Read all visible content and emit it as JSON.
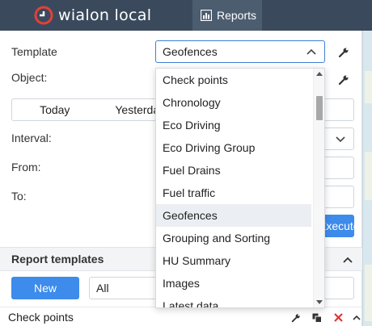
{
  "topbar": {
    "logo_text": "wialon local",
    "reports_tab_label": "Reports",
    "background": "#3a4a5c"
  },
  "form": {
    "template_label": "Template",
    "template_value": "Geofences",
    "object_label": "Object:",
    "period_segments": [
      "Today",
      "Yesterday",
      "",
      ""
    ],
    "interval_label": "Interval:",
    "from_label": "From:",
    "to_label": "To:",
    "execute_label": "Execute"
  },
  "report_templates": {
    "title": "Report templates",
    "new_button_label": "New",
    "filter_value": "All",
    "rows": [
      {
        "name": "Check points"
      }
    ]
  },
  "dropdown": {
    "items": [
      "Check points",
      "Chronology",
      "Eco Driving",
      "Eco Driving Group",
      "Fuel Drains",
      "Fuel traffic",
      "Geofences",
      "Grouping and Sorting",
      "HU Summary",
      "Images",
      "Latest data"
    ],
    "selected": "Geofences"
  },
  "colors": {
    "accent": "#3d8bea",
    "focus_border": "#3e7fd6",
    "delete_icon": "#e0302f"
  },
  "icons": {
    "logo": "wialon-logo-icon",
    "reports": "chart-icon",
    "wrench": "wrench-icon",
    "copy": "copy-icon",
    "delete": "close-icon",
    "chevron_up": "chevron-up-icon",
    "chevron_down": "chevron-down-icon"
  }
}
